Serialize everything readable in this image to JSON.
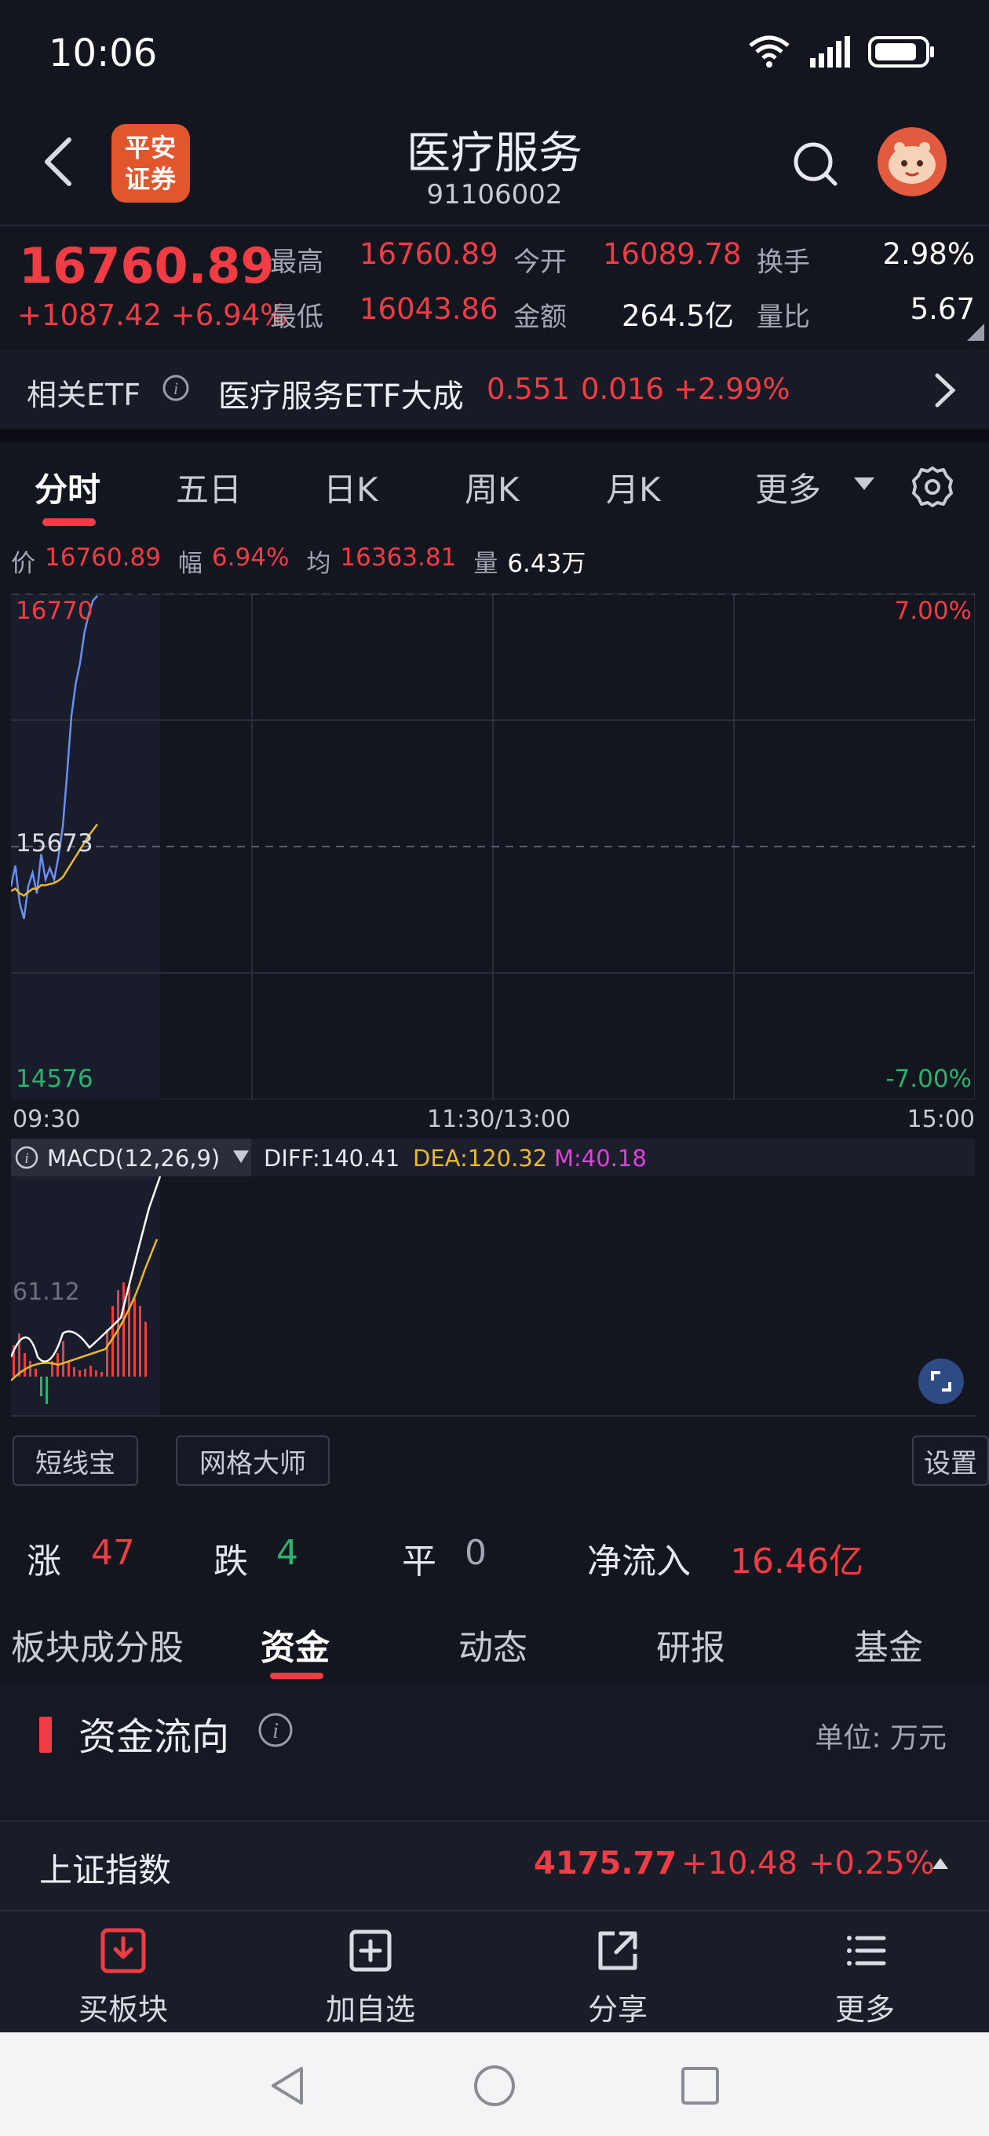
{
  "status_bar": {
    "time": "10:06"
  },
  "header": {
    "title": "医疗服务",
    "code": "91106002",
    "broker_logo": "平安\n证券"
  },
  "quote": {
    "price": "16760.89",
    "change": "+1087.42 +6.94%",
    "high_label": "最高",
    "high": "16760.89",
    "low_label": "最低",
    "low": "16043.86",
    "open_label": "今开",
    "open": "16089.78",
    "amount_label": "金额",
    "amount": "264.5亿",
    "turnover_label": "换手",
    "turnover": "2.98%",
    "volume_ratio_label": "量比",
    "volume_ratio": "5.67"
  },
  "etf": {
    "label": "相关ETF",
    "name": "医疗服务ETF大成",
    "price": "0.551",
    "change": "0.016",
    "pct": "+2.99%"
  },
  "chart_tabs": [
    "分时",
    "五日",
    "日K",
    "周K",
    "月K",
    "更多"
  ],
  "info_line": {
    "price_label": "价",
    "price": "16760.89",
    "range_label": "幅",
    "range": "6.94%",
    "avg_label": "均",
    "avg": "16363.81",
    "vol_label": "量",
    "vol": "6.43万"
  },
  "chart_axis": {
    "y_top": "16770",
    "y_mid": "15673",
    "y_bottom": "14576",
    "pct_top": "7.00%",
    "pct_bottom": "-7.00%",
    "t_start": "09:30",
    "t_mid": "11:30/13:00",
    "t_end": "15:00"
  },
  "macd": {
    "label": "MACD(12,26,9)",
    "diff": "DIFF:140.41",
    "dea": "DEA:120.32",
    "m": "M:40.18",
    "level": "61.12"
  },
  "tools": {
    "left1": "短线宝",
    "left2": "网格大师",
    "right": "设置"
  },
  "stats": {
    "up_label": "涨",
    "up": "47",
    "down_label": "跌",
    "down": "4",
    "flat_label": "平",
    "flat": "0",
    "inflow_label": "净流入",
    "inflow": "16.46亿"
  },
  "sub_tabs": [
    "板块成分股",
    "资金",
    "动态",
    "研报",
    "基金"
  ],
  "section": {
    "title": "资金流向",
    "unit": "单位:  万元"
  },
  "index_bar": {
    "name": "上证指数",
    "price": "4175.77",
    "change": "+10.48",
    "pct": "+0.25%"
  },
  "bottom_nav": [
    "买板块",
    "加自选",
    "分享",
    "更多"
  ],
  "chart_data": {
    "type": "line",
    "title": "",
    "xlabel": "",
    "ylabel": "",
    "ylim": [
      14576,
      16770
    ],
    "x_range": [
      "09:30",
      "15:00"
    ],
    "series": [
      {
        "values": [
          15500,
          15590,
          15430,
          15360,
          15500,
          15560,
          15470,
          15640,
          15530,
          15580,
          15530,
          15630,
          15760,
          15990,
          16240,
          16380,
          16470,
          16600,
          16680,
          16740,
          16760.89
        ],
        "color": "#6a8ff0"
      },
      {
        "values": [
          15480,
          15490,
          15470,
          15460,
          15475,
          15490,
          15490,
          15505,
          15505,
          15510,
          15515,
          15525,
          15540,
          15570,
          15600,
          15630,
          15660,
          15690,
          15720,
          15745,
          15770
        ],
        "color": "#e8b930"
      }
    ]
  }
}
